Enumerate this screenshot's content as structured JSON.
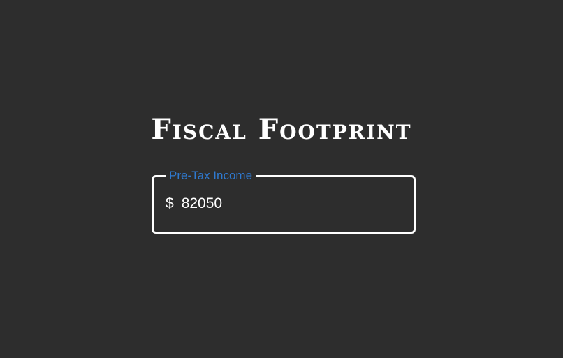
{
  "app": {
    "title": "Fiscal Footprint"
  },
  "income": {
    "label": "Pre-Tax Income",
    "currency_symbol": "$",
    "value": "82050"
  },
  "colors": {
    "background": "#2d2d2d",
    "text": "#ffffff",
    "accent": "#2f7ad1"
  }
}
